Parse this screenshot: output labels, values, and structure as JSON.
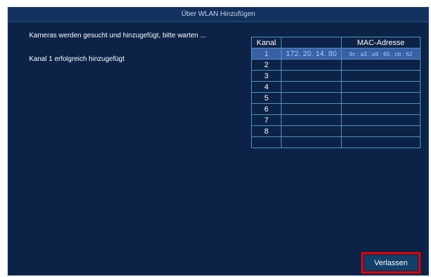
{
  "dialog": {
    "title": "Über WLAN Hinzufügen",
    "status_message": "Kameras werden gesucht und hinzugefügt, bitte warten ...",
    "result_message": "Kanal 1 erfolgreich hinzugefügt"
  },
  "table": {
    "headers": [
      "Kanal",
      "",
      "MAC-Adresse"
    ],
    "rows": [
      {
        "kanal": "1",
        "ip": "172. 20. 14. 80",
        "mac": "9c : a3 : a9 : 65 : cb : 62"
      },
      {
        "kanal": "2",
        "ip": "",
        "mac": ""
      },
      {
        "kanal": "3",
        "ip": "",
        "mac": ""
      },
      {
        "kanal": "4",
        "ip": "",
        "mac": ""
      },
      {
        "kanal": "5",
        "ip": "",
        "mac": ""
      },
      {
        "kanal": "6",
        "ip": "",
        "mac": ""
      },
      {
        "kanal": "7",
        "ip": "",
        "mac": ""
      },
      {
        "kanal": "8",
        "ip": "",
        "mac": ""
      },
      {
        "kanal": "",
        "ip": "",
        "mac": ""
      }
    ]
  },
  "buttons": {
    "exit_label": "Verlassen"
  },
  "colors": {
    "background": "#0c2347",
    "selected_row": "#3a5fa8",
    "highlight_border": "#e0000a"
  }
}
